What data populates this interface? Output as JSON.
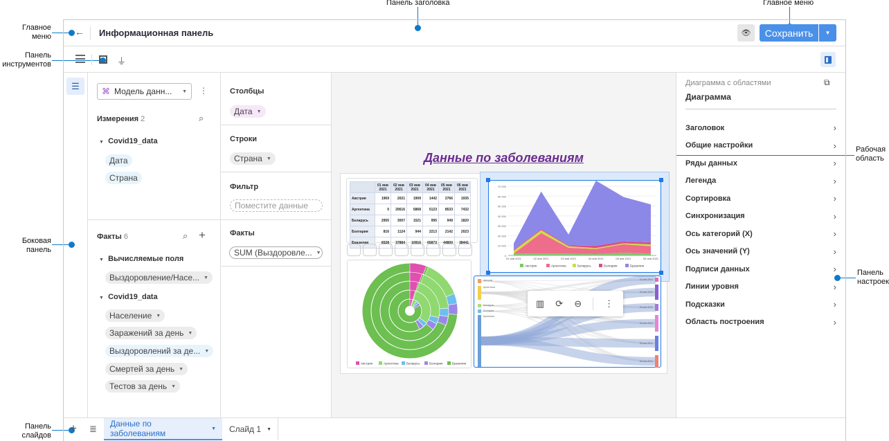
{
  "annotations": {
    "title_panel": "Панель заголовка",
    "main_menu_right": "Главное меню",
    "main_menu_left": "Главное меню",
    "toolbar": "Панель инструментов",
    "work_area": "Рабочая область",
    "side_panel": "Боковая панель",
    "settings_panel": "Панель настроек",
    "slides_panel": "Панель слайдов"
  },
  "header": {
    "title": "Информационная панель",
    "save_label": "Сохранить"
  },
  "data_panel": {
    "model_select": "Модель данн...",
    "dimensions_label": "Измерения",
    "dimensions_count": "2",
    "dim_group": "Covid19_data",
    "dim_items": [
      "Дата",
      "Страна"
    ],
    "facts_label": "Факты",
    "facts_count": "6",
    "calc_group": "Вычисляемые поля",
    "calc_items": [
      "Выздоровление/Насе..."
    ],
    "fact_group": "Covid19_data",
    "fact_items": [
      "Население",
      "Заражений за день",
      "Выздоровлений за де...",
      "Смертей за день",
      "Тестов за день"
    ]
  },
  "fields_panel": {
    "columns_label": "Столбцы",
    "columns_item": "Дата",
    "rows_label": "Строки",
    "rows_item": "Страна",
    "filter_label": "Фильтр",
    "filter_placeholder": "Поместите данные",
    "facts_label": "Факты",
    "facts_item": "SUM (Выздоровле..."
  },
  "canvas": {
    "title": "Данные по заболеваниям",
    "title_color": "#6a2c91"
  },
  "settings": {
    "subtitle": "Диаграмма с областями",
    "title": "Диаграмма",
    "items": [
      "Заголовок",
      "Общие настройки",
      "Ряды данных",
      "Легенда",
      "Сортировка",
      "Синхронизация",
      "Ось категорий (X)",
      "Ось значений (Y)",
      "Подписи данных",
      "Линии уровня",
      "Подсказки",
      "Область построения"
    ]
  },
  "slides": {
    "tabs": [
      "Данные по заболеваниям",
      "Слайд 1"
    ]
  },
  "colors": {
    "accent": "#4a90e8"
  },
  "chart_data": {
    "type": "area",
    "stacked": true,
    "categories": [
      "01 янв 2021",
      "02 янв 2021",
      "03 янв 2021",
      "04 янв 2021",
      "05 янв 2021",
      "06 янв 2021"
    ],
    "ylim": [
      0,
      70000
    ],
    "yticks": [
      "0",
      "10 000",
      "20 000",
      "30 000",
      "40 000",
      "50 000",
      "60 000",
      "70 000"
    ],
    "legend": "bottom",
    "series": [
      {
        "name": "Австрия",
        "color": "#7cc96a",
        "values": [
          1969,
          2021,
          1909,
          1442,
          2766,
          1935
        ]
      },
      {
        "name": "Аргентина",
        "color": "#ee6d8a",
        "values": [
          0,
          20616,
          5868,
          5123,
          8533,
          7432
        ]
      },
      {
        "name": "Беларусь",
        "color": "#cfdc4a",
        "values": [
          2955,
          3007,
          1521,
          995,
          949,
          1820
        ]
      },
      {
        "name": "Болгария",
        "color": "#d6508a",
        "values": [
          816,
          1124,
          944,
          2213,
          2142,
          2023
        ]
      },
      {
        "name": "Бразилия",
        "color": "#8c88e8",
        "values": [
          6528,
          37884,
          10916,
          65873,
          44800,
          38441
        ]
      }
    ]
  },
  "donut_legend": [
    {
      "name": "Австрия",
      "color": "#e050b0"
    },
    {
      "name": "Аргентина",
      "color": "#90d870"
    },
    {
      "name": "Беларусь",
      "color": "#6cc0ea"
    },
    {
      "name": "Болгария",
      "color": "#9a88e8"
    },
    {
      "name": "Бразилия",
      "color": "#6cbf50"
    }
  ],
  "sankey": {
    "sources": [
      "Австрия",
      "Аргентина",
      "Беларусь",
      "Болгария",
      "Бразилия"
    ],
    "targets": [
      "01 янв 2021",
      "02 янв 2021",
      "03 янв 2021",
      "04 янв 2021",
      "05 янв 2021",
      "06 янв 2021"
    ]
  }
}
